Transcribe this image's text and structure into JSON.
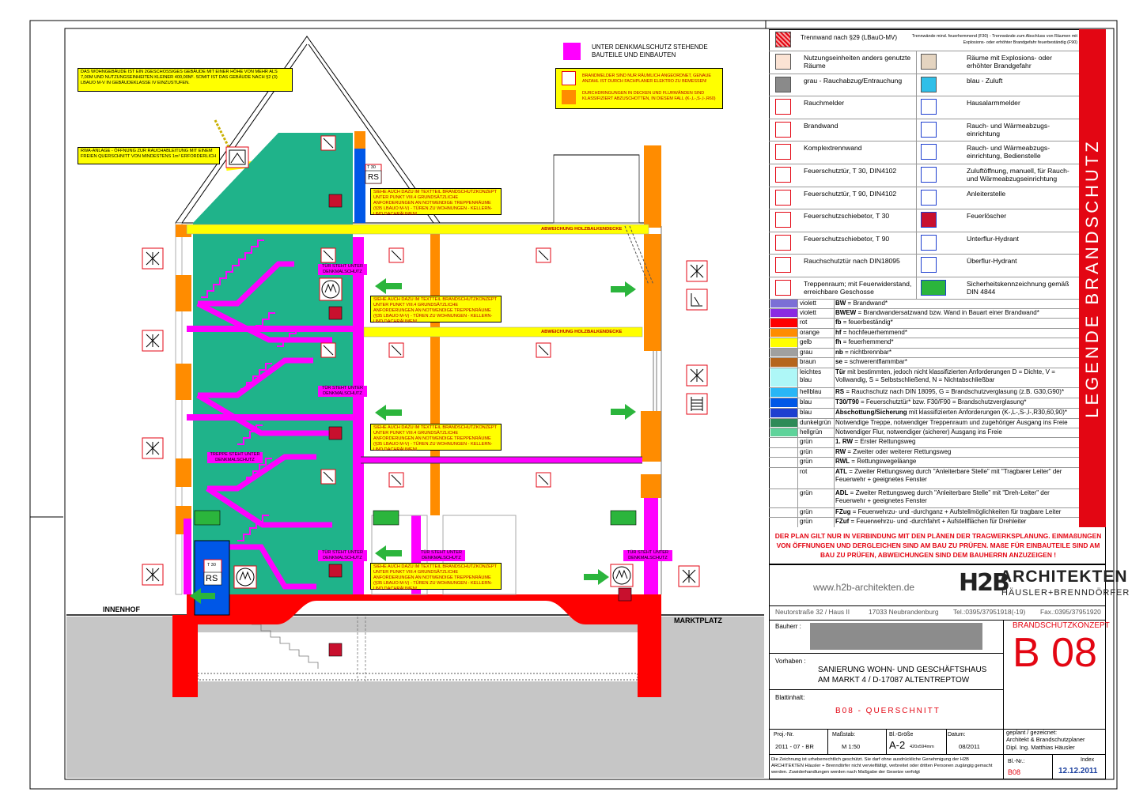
{
  "drawing": {
    "notes": {
      "building_class": "DAS WOHNGEBÄUDE IST EIN 2GESCHOSSIGES GEBÄUDE MIT EINER HÖHE VON MEHR ALS 7,00M UND NUTZUNGSEINHEITEN KLEINER 400,00M². SOMIT IST DAS GEBÄUDE NACH §2 (3) LBAUO M-V IN GEBÄUDEKLASSE IV EINZUSTUFEN.",
      "rwa": "RWA-ANLAGE - ÖFFNUNG ZUR RAUCHABLEITUNG MIT EINEM FREIEN QUERSCHNITT VON MINDESTENS 1m² ERFORDERLICH",
      "denkmal": "UNTER DENKMALSCHUTZ STEHENDE BAUTEILE UND EINBAUTEN",
      "brandmelder": "BRANDMELDER SIND NUR RÄUMLICH ANGEORDNET, GENAUE ANZAHL IST DURCH FACHPLANER ELEKTRO ZU BEMESSEN!",
      "durchdringungen": "DURCHDRINGUNGEN IN DECKEN UND FLURWÄNDEN SIND KLASSIFIZIERT ABZUSCHOTTEN, IN DIESEM FALL (K-,L-,S-,I-,R60)",
      "treppenraum": "SIEHE AUCH DAZU IM TEXTTEIL BRANDSCHUTZKONZEPT UNTER PUNKT VIII.4 GRUNDSÄTZLICHE ANFORDERUNGEN AN NOTWENDIGE TREPPENRÄUME (§35 LBAUO M-V) - TÜREN ZU WOHNUNGEN - KELLERN- UND DACHRÄUMEN!",
      "holzbalken": "ABWEICHUNG HOLZBALKENDECKE",
      "tuer_denkmal": "TÜR STEHT UNTER DENKMALSCHUTZ",
      "treppe_denkmal": "TREPPE STEHT UNTER DENKMALSCHUTZ"
    },
    "labels": {
      "innenhof": "INNENHOF",
      "marktplatz": "MARKTPLATZ",
      "rs": "RS",
      "t30": "T 30"
    }
  },
  "legend": {
    "title": "LEGENDE BRANDSCHUTZ",
    "head_row": {
      "label": "Trennwand nach §29 (LBauO-MV)",
      "small": "Trennwände mind. feuerhemmend (F30) - Trennwände zum Abschluss von Räumen mit Explosions- oder erhöhter Brandgefahr feuerbeständig (F90)"
    },
    "symbol_rows": [
      {
        "left": "Nutzungseinheiten anders genutzte Räume",
        "right": "Räume mit Explosions- oder erhöhter Brandgefahr"
      },
      {
        "left": "grau - Rauchabzug/Entrauchung",
        "right": "blau - Zuluft"
      },
      {
        "left": "Rauchmelder",
        "right": "Hausalarmmelder"
      },
      {
        "left": "Brandwand",
        "right": "Rauch- und Wärmeabzugs- einrichtung"
      },
      {
        "left": "Komplextrennwand",
        "right": "Rauch- und Wärmeabzugs- einrichtung, Bedienstelle"
      },
      {
        "left": "Feuerschutztür, T 30, DIN4102",
        "right": "Zuluftöffnung, manuell, für Rauch- und Wärmeabzugseinrichtung"
      },
      {
        "left": "Feuerschutztür, T 90, DIN4102",
        "right": "Anleiterstelle"
      },
      {
        "left": "Feuerschutzschiebetor, T 30",
        "right": "Feuerlöscher"
      },
      {
        "left": "Feuerschutzschiebetor, T 90",
        "right": "Unterflur-Hydrant"
      },
      {
        "left": "Rauchschutztür nach DIN18095",
        "right": "Überflur-Hydrant"
      },
      {
        "left": "Treppenraum; mit Feuerwiderstand, erreichbare Geschosse",
        "right": "Sicherheitskennzeichnung gemäß DIN 4844"
      }
    ],
    "color_rows": [
      {
        "color": "#7b6fd6",
        "name": "violett",
        "code": "BW",
        "text": " = Brandwand*"
      },
      {
        "color": "#8a2be2",
        "name": "violett",
        "code": "BWEW",
        "text": " = Brandwandersatzwand bzw. Wand in Bauart einer Brandwand*"
      },
      {
        "color": "#ff0000",
        "name": "rot",
        "code": "fb",
        "text": " = feuerbeständig*"
      },
      {
        "color": "#ff8c00",
        "name": "orange",
        "code": "hf",
        "text": " = hochfeuerhemmend*"
      },
      {
        "color": "#ffff00",
        "name": "gelb",
        "code": "fh",
        "text": " = feuerhemmend*"
      },
      {
        "color": "#a0a0a0",
        "name": "grau",
        "code": "nb",
        "text": " = nichtbrennbar*"
      },
      {
        "color": "#b5651d",
        "name": "braun",
        "code": "se",
        "text": " = schwerentflammbar*"
      },
      {
        "color": "#aef7f7",
        "name": "leichtes blau",
        "code": "Tür",
        "text": " mit bestimmten, jedoch nicht klassifizierten Anforderungen D = Dichte, V = Vollwandig, S = Selbstschließend, N = Nichtabschließbar"
      },
      {
        "color": "#29b6f6",
        "name": "hellblau",
        "code": "RS",
        "text": " = Rauchschutz nach DIN 18095, G = Brandschutzverglasung (z.B. G30,G90)*"
      },
      {
        "color": "#0057e7",
        "name": "blau",
        "code": "T30/T90",
        "text": " = Feuerschutztür* bzw. F30/F90 = Brandschutzverglasung*"
      },
      {
        "color": "#1e3fd0",
        "name": "blau",
        "code": "Abschottung/Sicherung",
        "text": " mit klassifizierten Anforderungen (K-,L-,S-,I-,R30,60,90)*"
      },
      {
        "color": "#2e8b57",
        "name": "dunkelgrün",
        "code": "",
        "text": "Notwendige Treppe, notwendiger Treppenraum und zugehöriger Ausgang ins Freie"
      },
      {
        "color": "#5ed39a",
        "name": "hellgrün",
        "code": "",
        "text": "Notwendiger Flur, notwendiger (sicherer) Ausgang ins Freie"
      },
      {
        "color": "",
        "name": "grün",
        "code": "1. RW",
        "text": " = Erster Rettungsweg"
      },
      {
        "color": "",
        "name": "grün",
        "code": "RW",
        "text": " = Zweiter oder weiterer Rettungsweg"
      },
      {
        "color": "",
        "name": "grün",
        "code": "RWL",
        "text": " = Rettungswegeläange"
      },
      {
        "color": "",
        "name": "rot",
        "code": "ATL",
        "text": " = Zweiter Rettungsweg durch \"Anleiterbare Stelle\" mit \"Tragbarer Leiter\" der Feuerwehr + geeignetes Fenster"
      },
      {
        "color": "",
        "name": "grün",
        "code": "ADL",
        "text": " = Zweiter Rettungsweg durch \"Anleiterbare Stelle\" mit \"Dreh-Leiter\" der Feuerwehr + geeignetes Fenster"
      },
      {
        "color": "",
        "name": "grün",
        "code": "FZug",
        "text": " = Feuerwehrzu- und -durchganz + Aufstellmöglichkeiten für tragbare Leiter"
      },
      {
        "color": "",
        "name": "grün",
        "code": "FZuf",
        "text": " = Feuerwehrzu- und -durchfahrt + Aufstellflächen für Drehleiter"
      }
    ],
    "warning": "DER PLAN GILT NUR IN VERBINDUNG MIT DEN PLÄNEN DER TRAGWERKSPLANUNG. EINMAßUNGEN VON ÖFFNUNGEN UND DERGLEICHEN SIND AM BAU ZU PRÜFEN. MAßE FÜR EINBAUTEILE SIND AM BAU ZU PRÜFEN, ABWEICHUNGEN SIND DEM BAUHERRN ANZUZEIGEN !"
  },
  "titleblock": {
    "website": "www.h2b-architekten.de",
    "logo_mark": "H2B",
    "logo_title": "ARCHITEKTEN",
    "logo_sub": "HÄUSLER+BRENNDÖRFER",
    "address": "Neutorstraße 32 / Haus II",
    "city": "17033 Neubrandenburg",
    "tel": "Tel.:0395/37951918(-19)",
    "fax": "Fax.:0395/37951920",
    "bauherr_label": "Bauherr :",
    "concept_label": "BRANDSCHUTZKONZEPT",
    "sheet_code": "B 08",
    "vorhaben_label": "Vorhaben :",
    "vorhaben_line1": "SANIERUNG WOHN- UND GESCHÄFTSHAUS",
    "vorhaben_line2": "AM MARKT 4  /  D-17087 ALTENTREPTOW",
    "blattinhalt_label": "Blattinhalt:",
    "blattinhalt": "B08 - QUERSCHNITT",
    "proj_label": "Proj.-Nr.",
    "proj": "2011 - 07 - BR",
    "massstab_label": "Maßstab:",
    "massstab": "M 1:50",
    "blgroesse_label": "Bl.-Größe",
    "blgroesse": "A-2",
    "blgroesse_small": "420x594mm",
    "datum_label": "Datum:",
    "datum": "08/2011",
    "planer_label": "geplant / gezeicnet:",
    "planer1": "Architekt & Brandschutzplaner",
    "planer2": "Dipl. Ing. Matthias Häusler",
    "copyright": "Die Zeichnung ist urheberrechtlich geschützt. Sie darf ohne ausdrückliche Genehmigung der H2B ARCHITEKTEN Häusler + Brenndörfer nicht vervielfältigt, verbreitet oder dritten Personen zugängig gemacht werden. Zuwiderhandlungen werden nach Maßgabe der Gesetze verfolgt",
    "blnr_label": "Bl.-Nr.:",
    "blnr": "B08",
    "index_label": "Index",
    "index": "12.12.2011"
  }
}
